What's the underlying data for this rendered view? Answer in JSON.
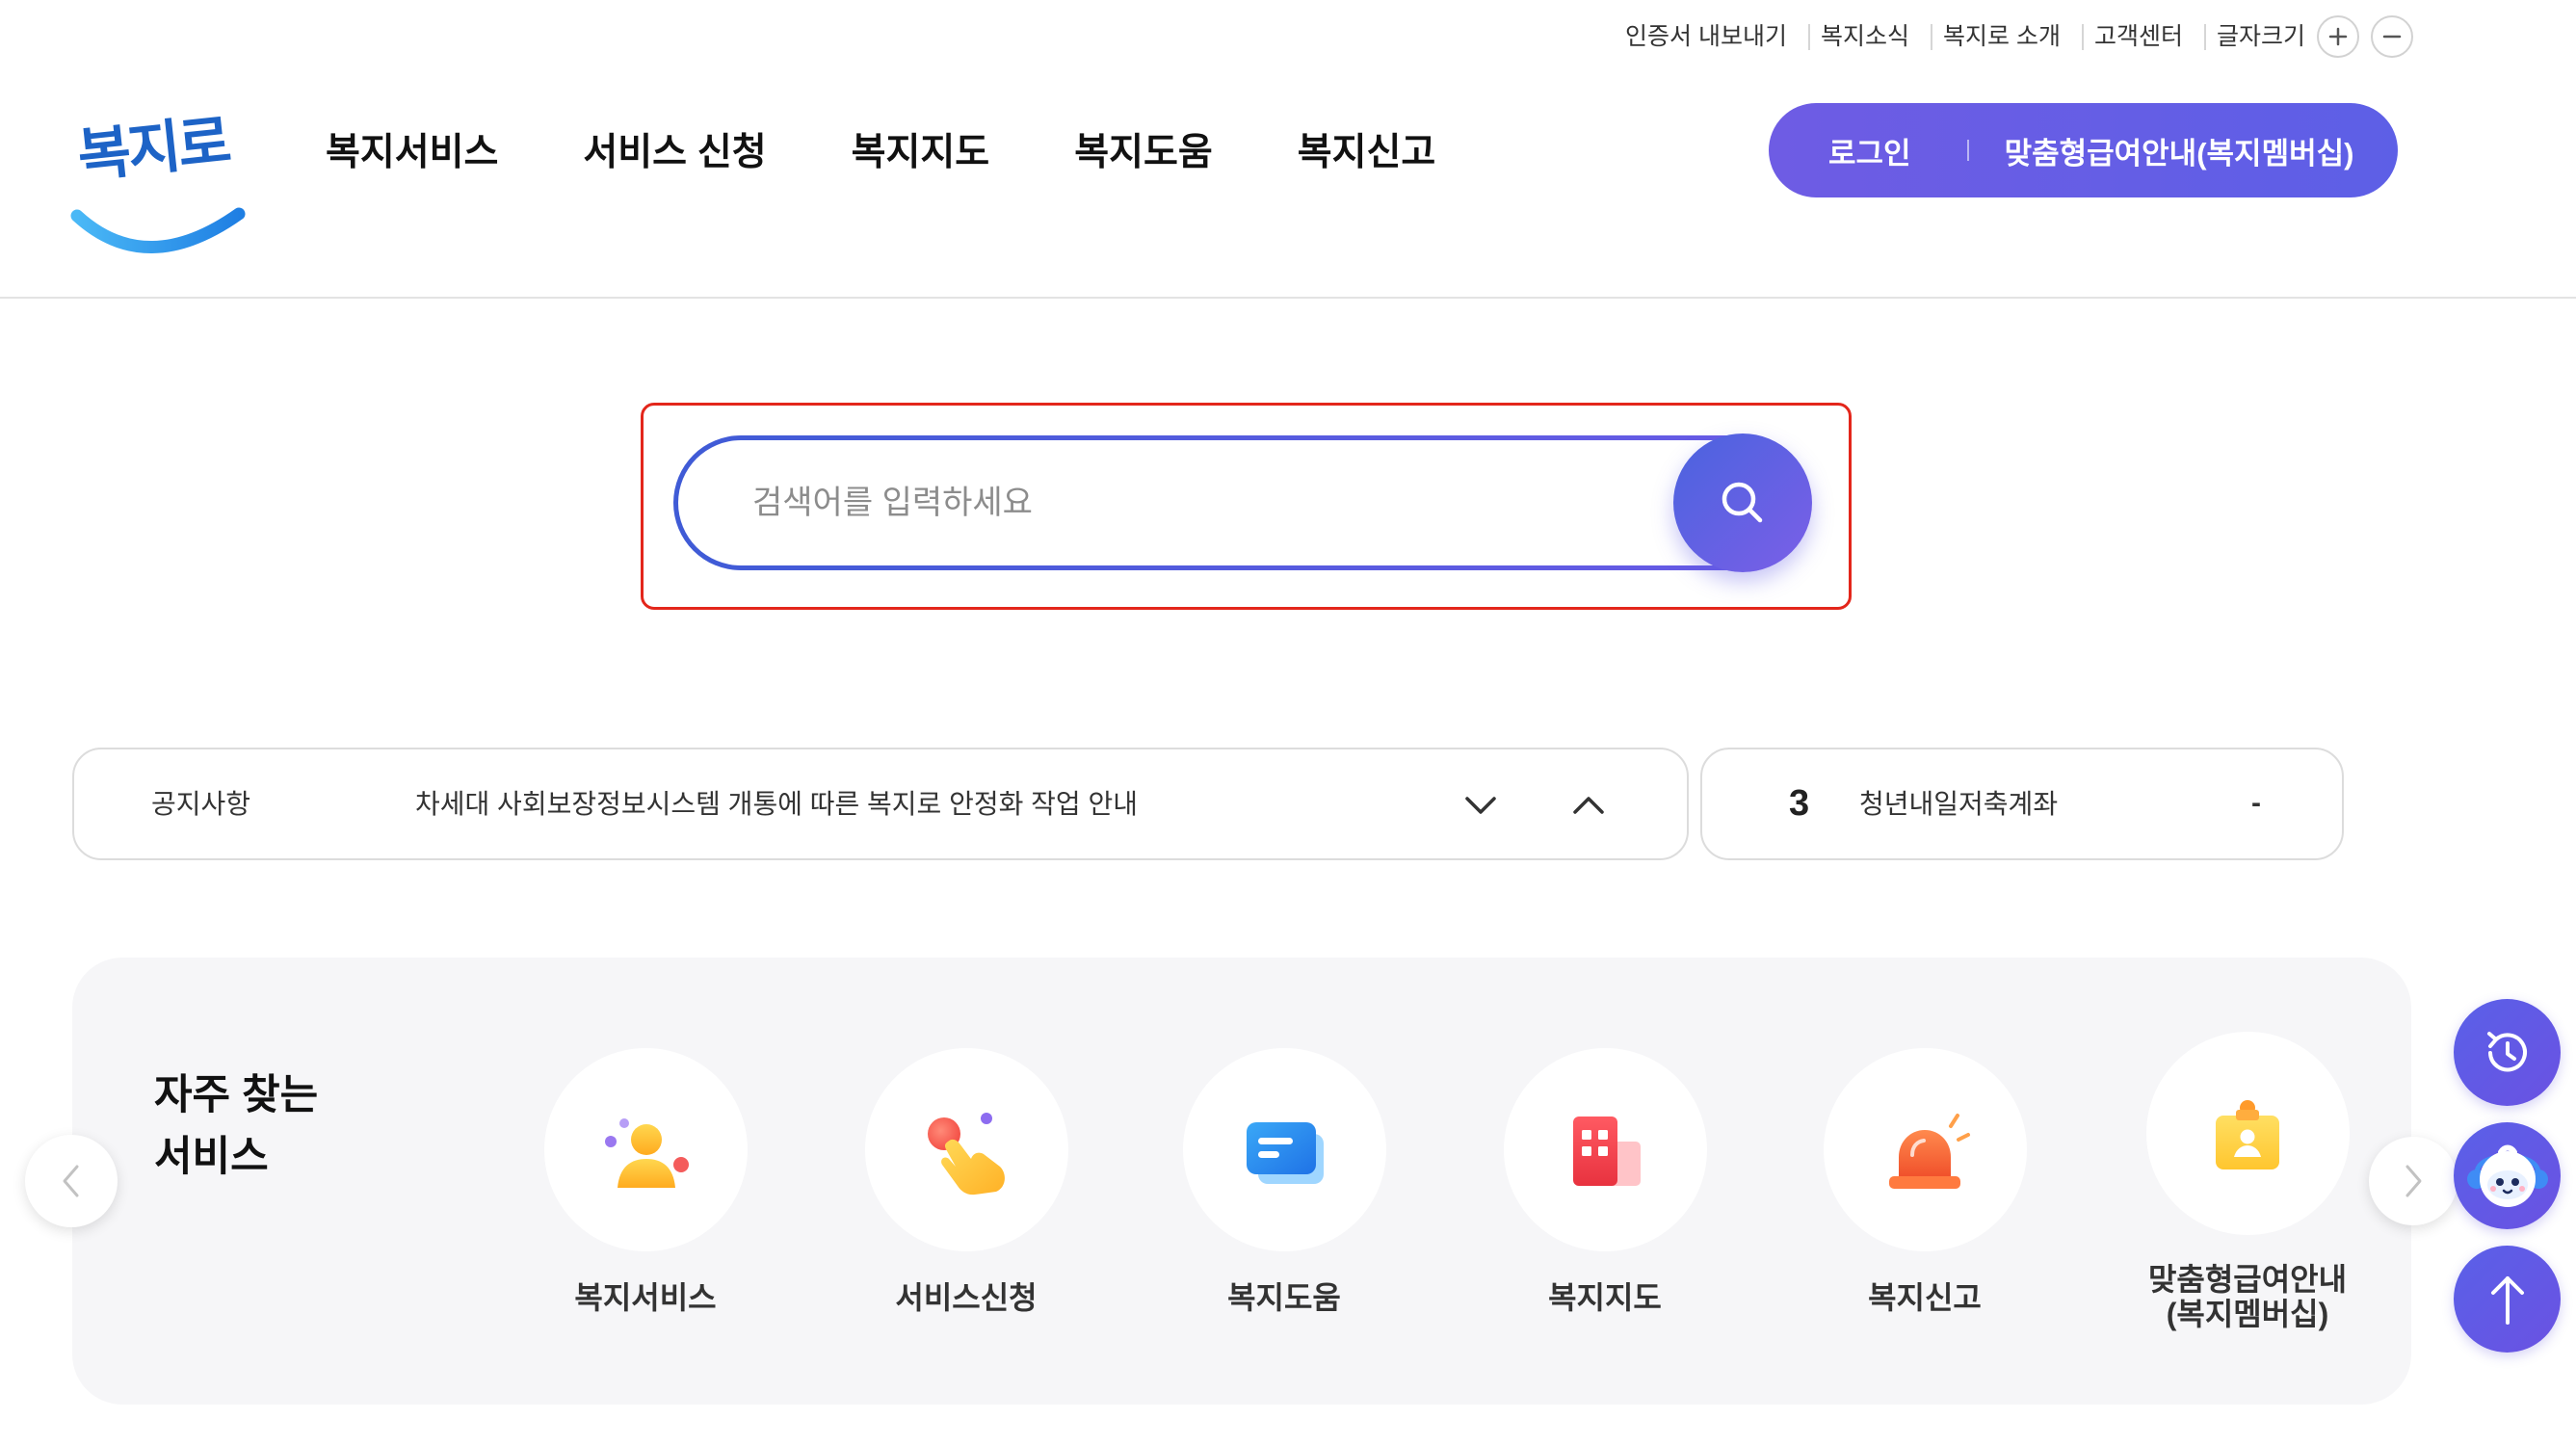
{
  "colors": {
    "accent": "#5d5fe6",
    "accent_gradient_start": "#4a63df",
    "accent_gradient_end": "#7b5fe7",
    "highlight_border": "#e3261b",
    "panel_background": "#f6f6f8",
    "logo_blue": "#1d63c6"
  },
  "util_links": [
    {
      "label": "인증서 내보내기"
    },
    {
      "label": "복지소식"
    },
    {
      "label": "복지로 소개"
    },
    {
      "label": "고객센터"
    },
    {
      "label": "글자크기"
    }
  ],
  "font_size": {
    "increase_icon": "plus-icon",
    "decrease_icon": "minus-icon"
  },
  "logo": {
    "text": "복지로"
  },
  "nav": [
    {
      "label": "복지서비스"
    },
    {
      "label": "서비스 신청"
    },
    {
      "label": "복지지도"
    },
    {
      "label": "복지도움"
    },
    {
      "label": "복지신고"
    }
  ],
  "login": {
    "login_label": "로그인",
    "membership_label": "맞춤형급여안내(복지멤버십)"
  },
  "search": {
    "placeholder": "검색어를 입력하세요",
    "value": "",
    "button_icon": "search-icon"
  },
  "notice": {
    "label": "공지사항",
    "text": "차세대 사회보장정보시스템 개통에 따른 복지로 안정화 작업 안내",
    "next_icon": "chevron-down-icon",
    "prev_icon": "chevron-up-icon"
  },
  "ranking": {
    "rank": "3",
    "keyword": "청년내일저축계좌",
    "change": "-"
  },
  "frequent": {
    "title_line1": "자주 찾는",
    "title_line2": "서비스",
    "prev_icon": "chevron-left-icon",
    "next_icon": "chevron-right-icon",
    "items": [
      {
        "label": "복지서비스",
        "icon": "person-icon"
      },
      {
        "label": "서비스신청",
        "icon": "hand-pointer-icon"
      },
      {
        "label": "복지도움",
        "icon": "chat-bubble-icon"
      },
      {
        "label": "복지지도",
        "icon": "building-icon"
      },
      {
        "label": "복지신고",
        "icon": "siren-icon"
      },
      {
        "label": "맞춤형급여안내\n(복지멤버십)",
        "icon": "id-badge-icon"
      }
    ]
  },
  "floating": [
    {
      "icon": "history-icon"
    },
    {
      "icon": "chatbot-icon"
    },
    {
      "icon": "arrow-up-icon"
    }
  ]
}
